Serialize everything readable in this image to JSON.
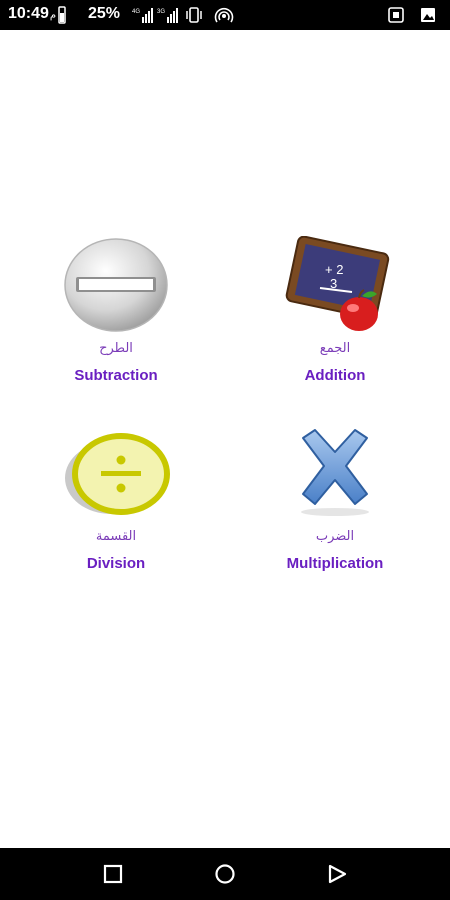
{
  "status_bar": {
    "time": "10:49",
    "time_suffix": "م",
    "battery": "25%"
  },
  "tiles": [
    {
      "arabic": "الطرح",
      "english": "Subtraction",
      "icon": "minus-circle-icon"
    },
    {
      "arabic": "الجمع",
      "english": "Addition",
      "icon": "chalkboard-apple-icon"
    },
    {
      "arabic": "القسمة",
      "english": "Division",
      "icon": "division-circle-icon"
    },
    {
      "arabic": "الضرب",
      "english": "Multiplication",
      "icon": "multiply-x-icon"
    }
  ],
  "chalkboard": {
    "line1": "+ 2",
    "line2": "3"
  },
  "colors": {
    "label_purple": "#6a1fc1",
    "arabic_purple": "#7b3cb8"
  }
}
